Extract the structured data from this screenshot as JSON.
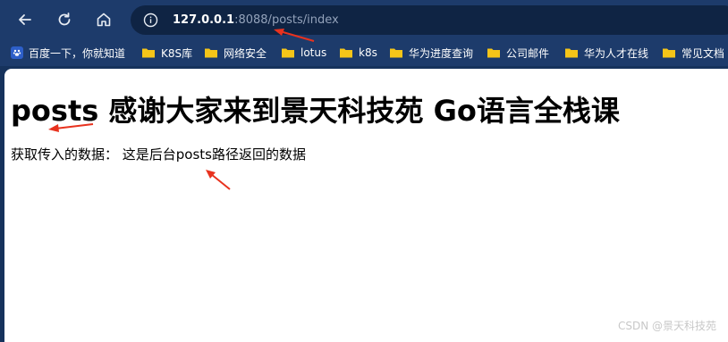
{
  "browser": {
    "url_host": "127.0.0.1",
    "url_rest": ":8088/posts/index",
    "bookmarks": [
      {
        "label": "百度一下，你就知道",
        "icon": "baidu-icon"
      },
      {
        "label": "K8S库",
        "icon": "folder-icon"
      },
      {
        "label": "网络安全",
        "icon": "folder-icon"
      },
      {
        "label": "lotus",
        "icon": "folder-icon"
      },
      {
        "label": "k8s",
        "icon": "folder-icon"
      },
      {
        "label": "华为进度查询",
        "icon": "folder-icon"
      },
      {
        "label": "公司邮件",
        "icon": "folder-icon"
      },
      {
        "label": "华为人才在线",
        "icon": "folder-icon"
      },
      {
        "label": "常见文档",
        "icon": "folder-icon"
      }
    ]
  },
  "page": {
    "heading": "posts 感谢大家来到景天科技苑 Go语言全栈课",
    "text": "获取传入的数据： 这是后台posts路径返回的数据"
  },
  "watermark": "CSDN @景天科技苑",
  "colors": {
    "chrome": "#1d3b6b",
    "annotation_arrow": "#e8321e",
    "folder": "#f5c518"
  }
}
